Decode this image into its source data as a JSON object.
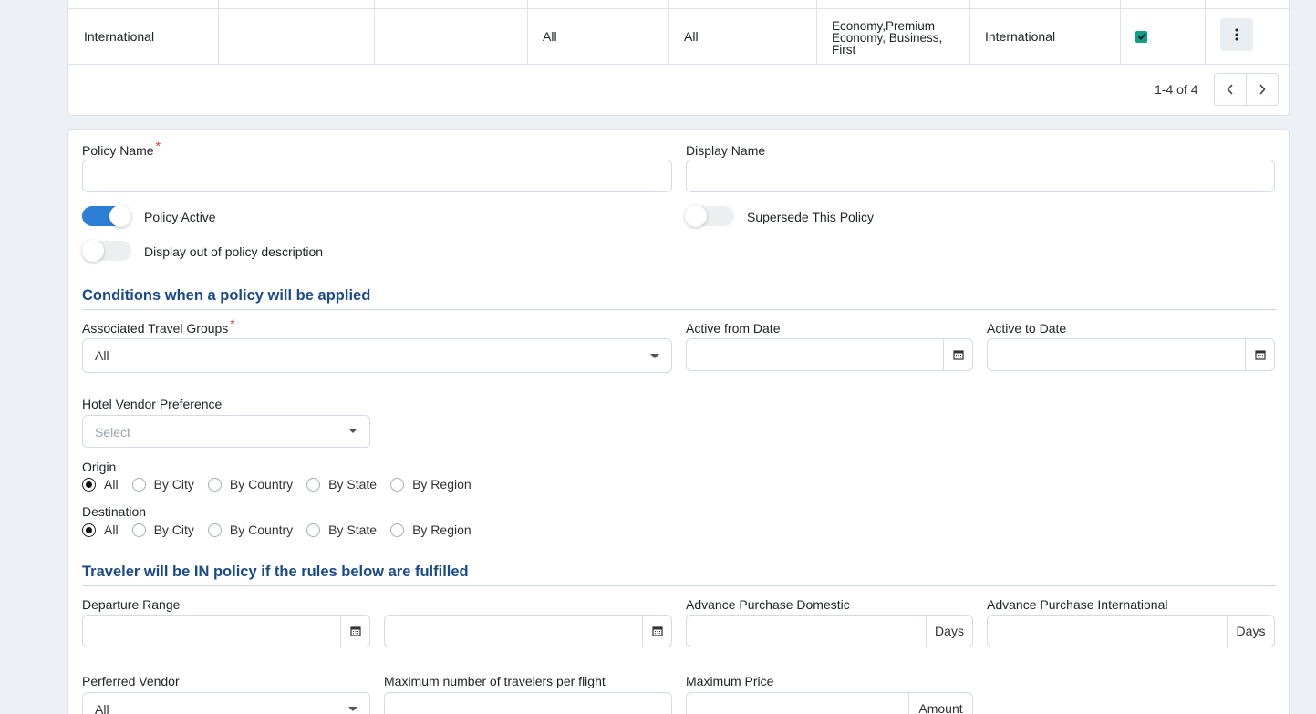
{
  "table": {
    "row": {
      "name": "International",
      "col2": "",
      "col3": "",
      "col4": "All",
      "col5": "All",
      "cabin_line1": "Economy,Premium",
      "cabin_line2": "Economy, Business,",
      "cabin_line3": "First",
      "type": "International",
      "active_checked": true
    },
    "pagination": {
      "text": "1-4 of 4"
    }
  },
  "form": {
    "policy_name": {
      "label": "Policy Name",
      "required": "*",
      "value": ""
    },
    "display_name": {
      "label": "Display Name",
      "value": ""
    },
    "policy_active": {
      "label": "Policy Active",
      "on": true
    },
    "supersede": {
      "label": "Supersede This Policy",
      "on": false
    },
    "display_out_of_policy": {
      "label": "Display out of policy description",
      "on": false
    },
    "conditions_title": "Conditions when a policy will be applied",
    "travel_groups": {
      "label": "Associated Travel Groups",
      "required": "*",
      "value": "All"
    },
    "active_from": {
      "label": "Active from Date",
      "value": ""
    },
    "active_to": {
      "label": "Active to Date",
      "value": ""
    },
    "hotel_vendor": {
      "label": "Hotel Vendor Preference",
      "placeholder": "Select"
    },
    "origin": {
      "label": "Origin",
      "options": [
        "All",
        "By City",
        "By Country",
        "By State",
        "By Region"
      ],
      "selected": "All"
    },
    "destination": {
      "label": "Destination",
      "options": [
        "All",
        "By City",
        "By Country",
        "By State",
        "By Region"
      ],
      "selected": "All"
    },
    "rules_title": "Traveler will be IN policy if the rules below are fulfilled",
    "departure_range": {
      "label": "Departure Range"
    },
    "advance_domestic": {
      "label": "Advance Purchase Domestic",
      "addon": "Days"
    },
    "advance_international": {
      "label": "Advance Purchase International",
      "addon": "Days"
    },
    "preferred_vendor": {
      "label": "Perferred Vendor",
      "value": "All"
    },
    "max_travelers": {
      "label": "Maximum number of travelers per flight"
    },
    "max_price": {
      "label": "Maximum Price",
      "addon": "Amount"
    }
  },
  "icons": {
    "calendar": "calendar-icon",
    "kebab": "kebab-menu-icon",
    "prev": "chevron-left-icon",
    "next": "chevron-right-icon",
    "caret": "caret-down-icon"
  },
  "colors": {
    "accent": "#2d7fd3",
    "section_title": "#1a4a8a",
    "checkbox": "#0f9e86",
    "required": "#e53935"
  }
}
